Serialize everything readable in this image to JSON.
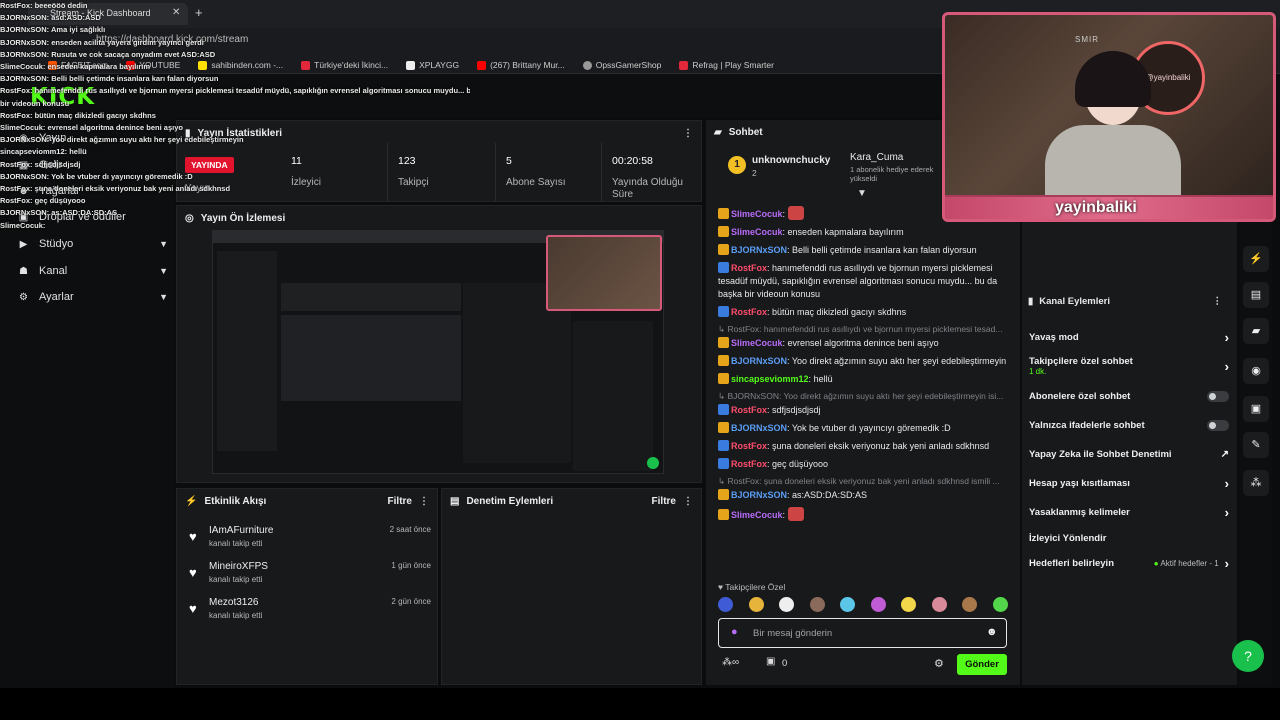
{
  "browser": {
    "tab_title": "Stream - Kick Dashboard",
    "url": "https://dashboard.kick.com/stream",
    "bookmarks": [
      "FACEIT.com",
      "YOUTUBE",
      "sahibinden.com -...",
      "Türkiye'deki İkinci...",
      "XPLAYGG",
      "(267) Brittany Mur...",
      "OpssGamerShop",
      "Refrag | Play Smarter"
    ]
  },
  "logo": "KICK",
  "sidebar": {
    "items": [
      {
        "label": "Yayın",
        "icon": "broadcast-icon"
      },
      {
        "label": "Gelir",
        "icon": "money-icon"
      },
      {
        "label": "Yağarlar",
        "icon": "people-icon"
      },
      {
        "label": "Droplar ve ödüller",
        "icon": "gift-icon"
      },
      {
        "label": "Stüdyo",
        "icon": "video-icon"
      },
      {
        "label": "Kanal",
        "icon": "channel-icon"
      },
      {
        "label": "Ayarlar",
        "icon": "gear-icon"
      }
    ]
  },
  "stats": {
    "title": "Yayın İstatistikleri",
    "live_badge": "YAYINDA",
    "stream_label": "Yayın",
    "viewers_value": "11",
    "viewers_label": "İzleyici",
    "followers_value": "123",
    "followers_label": "Takipçi",
    "subs_value": "5",
    "subs_label": "Abone Sayısı",
    "duration_value": "00:20:58",
    "duration_label": "Yayında Olduğu Süre"
  },
  "preview": {
    "title": "Yayın Ön İzlemesi"
  },
  "activity": {
    "title": "Etkinlik Akışı",
    "filter": "Filtre",
    "items": [
      {
        "name": "IAmAFurniture",
        "sub": "kanalı takip etti",
        "time": "2 saat önce"
      },
      {
        "name": "MineiroXFPS",
        "sub": "kanalı takip etti",
        "time": "1 gün önce"
      },
      {
        "name": "Mezot3126",
        "sub": "kanalı takip etti",
        "time": "2 gün önce"
      }
    ]
  },
  "moderation": {
    "title": "Denetim Eylemleri",
    "filter": "Filtre"
  },
  "chat": {
    "title": "Sohbet",
    "top_user": "unknownchucky",
    "top_count": "2",
    "gifter": "Kara_Cuma",
    "gifter_sub": "1 abonelik hediye ederek yükseldi",
    "messages": [
      {
        "name": "SlimeCocuk",
        "color": "#b86cf8",
        "text": ""
      },
      {
        "name": "SlimeCocuk",
        "color": "#b86cf8",
        "text": "enseden kapmalara bayılırım"
      },
      {
        "name": "BJORNxSON",
        "color": "#5b9ef5",
        "text": "Belli belli çetimde insanlara karı falan diyorsun"
      },
      {
        "name": "RostFox",
        "color": "#ff4d6d",
        "text": "hanımefenddi rus asıllıydı ve bjornun myersi picklemesi tesadüf müydü, sapıklığın evrensel algoritması sonucu muydu... bu da başka bir videoun konusu"
      },
      {
        "name": "RostFox",
        "color": "#ff4d6d",
        "text": "bütün maç dikizledi gacıyı skdhns"
      },
      {
        "reply": "RostFox: hanımefenddi rus asıllıydı ve bjornun myersi picklemesi tesad..."
      },
      {
        "name": "SlimeCocuk",
        "color": "#b86cf8",
        "text": "evrensel algoritma denince beni aşıyo"
      },
      {
        "name": "BJORNxSON",
        "color": "#5b9ef5",
        "text": "Yoo direkt ağzımın suyu aktı her şeyi edebileştirmeyin"
      },
      {
        "name": "sincapseviomm12",
        "color": "#53fc18",
        "text": "hellü"
      },
      {
        "reply": "BJORNxSON: Yoo direkt ağzımın suyu aktı her şeyi edebileştirmeyin isi..."
      },
      {
        "name": "RostFox",
        "color": "#ff4d6d",
        "text": "sdfjsdjsdjsdj"
      },
      {
        "name": "BJORNxSON",
        "color": "#5b9ef5",
        "text": "Yok be vtuber dı yayıncıyı göremedik :D"
      },
      {
        "name": "RostFox",
        "color": "#ff4d6d",
        "text": "şuna doneleri eksik veriyonuz bak yeni anladı sdkhnsd"
      },
      {
        "name": "RostFox",
        "color": "#ff4d6d",
        "text": "geç düşüyooo"
      },
      {
        "reply": "RostFox: şuna doneleri eksik veriyonuz bak yeni anladı sdkhnsd ismili ..."
      },
      {
        "name": "BJORNxSON",
        "color": "#5b9ef5",
        "text": "as:ASD:DA:SD:AS"
      },
      {
        "name": "SlimeCocuk",
        "color": "#b86cf8",
        "text": ""
      }
    ],
    "emote_label": "Takipçilere Özel",
    "input_placeholder": "Bir mesaj gönderin",
    "points": "0",
    "send_label": "Gönder"
  },
  "channel_actions": {
    "title": "Kanal Eylemleri",
    "rows": [
      {
        "label": "Yavaş mod",
        "control": "arrow"
      },
      {
        "label": "Takipçilere özel sohbet",
        "sub": "1 dk.",
        "control": "arrow"
      },
      {
        "label": "Abonelere özel sohbet",
        "control": "toggle"
      },
      {
        "label": "Yalnızca ifadelerle sohbet",
        "control": "toggle"
      },
      {
        "label": "Yapay Zeka ile Sohbet Denetimi",
        "control": "external"
      },
      {
        "label": "Hesap yaşı kısıtlaması",
        "control": "arrow"
      },
      {
        "label": "Yasaklanmış kelimeler",
        "control": "arrow"
      },
      {
        "label": "İzleyici Yönlendir",
        "control": "none"
      },
      {
        "label": "Hedefleri belirleyin",
        "control": "arrow",
        "status": "Aktif hedefler - 1"
      }
    ]
  },
  "webcam": {
    "name_tag": "yayinbaliki",
    "sign": "@yayinbaliki"
  },
  "overlay_chat": [
    "RostFox: beeeööö dedin",
    "BJORNxSON: asd:ASD:ASD",
    "BJORNxSON: Ama iyi sağlıklı",
    "BJORNxSON: enseden acilita yayera girdim yayınci gerdi",
    "BJORNxSON: Rusuta ve cok sacaça onyadım evet ASD:ASD",
    "SlimeCocuk: enseden kapmalara bayılırım",
    "BJORNxSON: Belli belli çetimde insanlara karı falan diyorsun",
    "RostFox: hanımefenddi rus asıllıydı ve bjornun myersi picklemesi tesadüf müydü, sapıklığın evrensel algoritması sonucu muydu... bu da başka",
    "bir videoun konusu",
    "RostFox: bütün maç dikizledi gacıyı skdhns",
    "SlimeCocuk: evrensel algoritma denince beni aşıyo",
    "BJORNxSON: Yoo direkt ağzımın suyu aktı her şeyi edebileştirmeyin",
    "sincapseviomm12: hellü",
    "RostFox: sdfjsdjsdjsdj",
    "BJORNxSON: Yok be vtuber dı yayıncıyı göremedik :D",
    "RostFox: şuna doneleri eksik veriyonuz bak yeni anladı sdkhnsd",
    "RostFox: geç düşüyooo",
    "BJORNxSON: as:ASD:DA:SD:AS",
    "SlimeCocuk:"
  ]
}
